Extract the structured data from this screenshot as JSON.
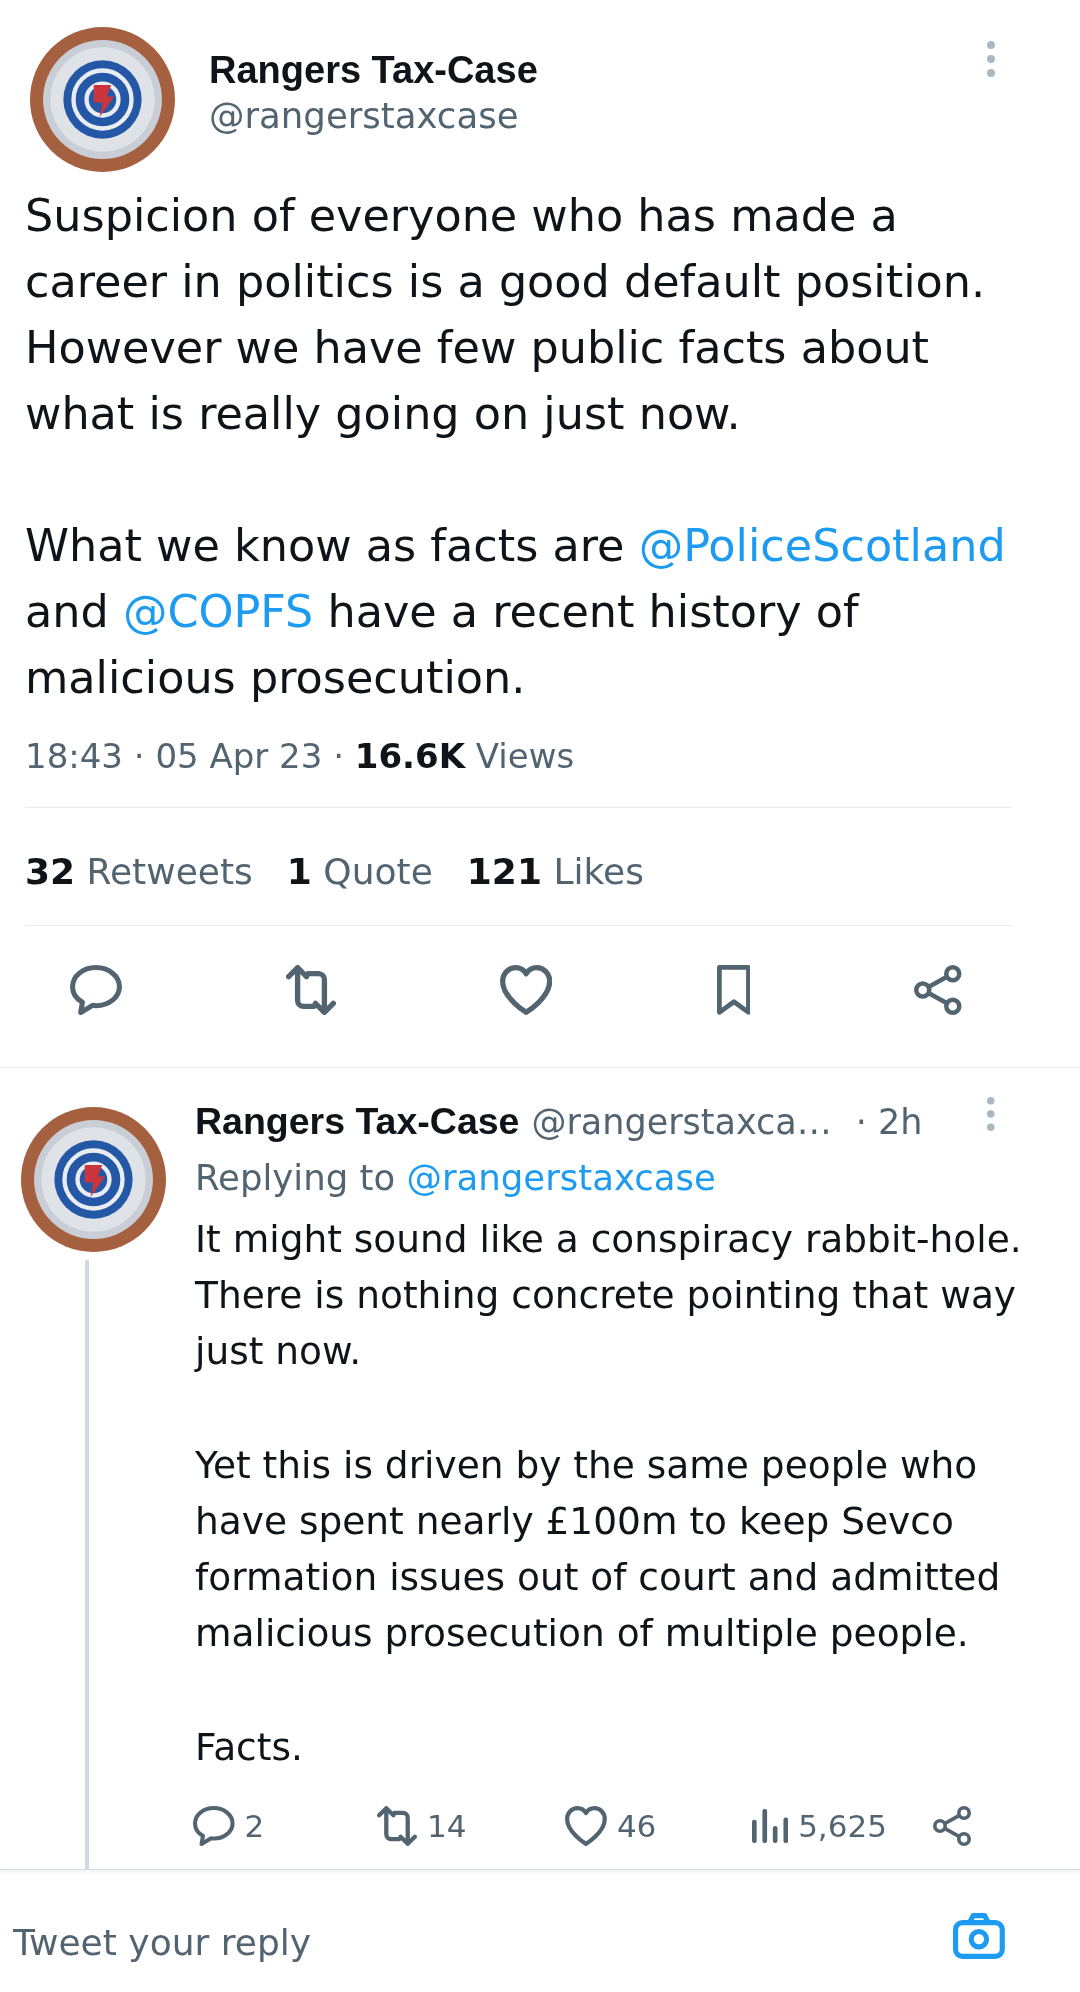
{
  "tweet": {
    "author": {
      "name": "Rangers Tax-Case",
      "handle": "@rangerstaxcase"
    },
    "body": [
      [
        {
          "kind": "text",
          "text": "Suspicion of everyone who has made a career in politics is a good default position. However we have few public facts about what is really going on just now."
        }
      ],
      [
        {
          "kind": "text",
          "text": "What we know as facts are "
        },
        {
          "kind": "mention",
          "text": "@PoliceScotland"
        },
        {
          "kind": "text",
          "text": " and "
        },
        {
          "kind": "mention",
          "text": "@COPFS"
        },
        {
          "kind": "text",
          "text": " have a recent history of malicious prosecution."
        }
      ]
    ],
    "meta": "18:43 · 05 Apr 23 · **16.6K** Views",
    "stats": [
      {
        "count": "32",
        "label": "Retweets"
      },
      {
        "count": "1",
        "label": "Quote"
      },
      {
        "count": "121",
        "label": "Likes"
      }
    ],
    "actions": [
      {
        "kind": "reply"
      },
      {
        "kind": "retweet"
      },
      {
        "kind": "like"
      },
      {
        "kind": "bookmark"
      },
      {
        "kind": "share"
      }
    ]
  },
  "reply": {
    "author": {
      "name": "Rangers Tax-Case",
      "handle": "@rangerstaxca…"
    },
    "time": "· 2h",
    "replying_to": {
      "label": "Replying to",
      "mention": "@rangerstaxcase"
    },
    "body": [
      "It might sound like a conspiracy rabbit-hole. There is nothing concrete pointing that way just now.",
      "Yet this is driven by the same people who have spent nearly £100m to keep Sevco formation issues out of court and admitted malicious prosecution of multiple people.",
      "Facts."
    ],
    "actions": [
      {
        "kind": "reply",
        "count": "2"
      },
      {
        "kind": "retweet",
        "count": "14"
      },
      {
        "kind": "like",
        "count": "46"
      },
      {
        "kind": "views",
        "count": "5,625"
      },
      {
        "kind": "share"
      }
    ]
  },
  "composer": {
    "placeholder": "Tweet your reply"
  }
}
